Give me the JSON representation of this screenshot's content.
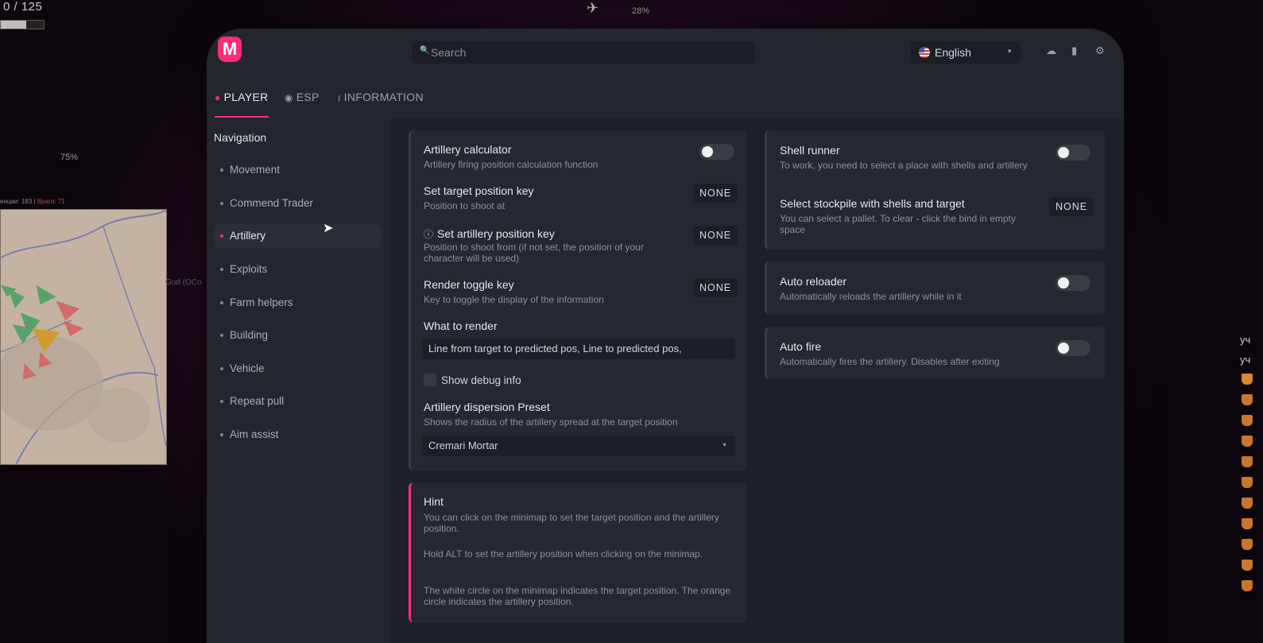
{
  "hud": {
    "counter": "0 / 125",
    "progress_fraction": 0.6,
    "top_percent": "28%",
    "side_percent": "75%",
    "stats_left": "енции: 183",
    "stats_right": "Враги: 71",
    "map_tag": "Gud (OCo",
    "right_text_1": "уч",
    "right_text_2": "уч"
  },
  "app": {
    "logo_letter": "M",
    "search": {
      "placeholder": "Search",
      "value": ""
    },
    "language": {
      "selected": "English"
    }
  },
  "tabs": [
    {
      "label": "PLAYER",
      "icon": "user-icon",
      "active": true
    },
    {
      "label": "ESP",
      "icon": "eye-icon",
      "active": false
    },
    {
      "label": "INFORMATION",
      "icon": "info-icon",
      "active": false
    }
  ],
  "nav": {
    "title": "Navigation",
    "items": [
      {
        "label": "Movement"
      },
      {
        "label": "Commend Trader"
      },
      {
        "label": "Artillery",
        "active": true
      },
      {
        "label": "Exploits"
      },
      {
        "label": "Farm helpers"
      },
      {
        "label": "Building"
      },
      {
        "label": "Vehicle"
      },
      {
        "label": "Repeat pull"
      },
      {
        "label": "Aim assist"
      }
    ]
  },
  "artillery": {
    "calculator": {
      "title": "Artillery calculator",
      "desc": "Artillery firing position calculation function",
      "enabled": false
    },
    "target_key": {
      "title": "Set target position key",
      "desc": "Position to shoot at",
      "key": "NONE"
    },
    "artillery_key": {
      "title": "Set artillery position key",
      "desc": "Position to shoot from (if not set, the position of your character will be used)",
      "key": "NONE"
    },
    "render_key": {
      "title": "Render toggle key",
      "desc": "Key to toggle the display of the information",
      "key": "NONE"
    },
    "what_to_render": {
      "title": "What to render",
      "value": "Line from target to predicted pos, Line to predicted pos,"
    },
    "debug": {
      "label": "Show debug info",
      "checked": false
    },
    "dispersion": {
      "title": "Artillery dispersion Preset",
      "desc": "Shows the radius of the artillery spread at the target position",
      "selected": "Cremari Mortar"
    }
  },
  "hint": {
    "title": "Hint",
    "p1": "You can click on the minimap to set the target position and the artillery position.",
    "p2": "Hold ALT to set the artillery position when clicking on the minimap.",
    "p3": "The white circle on the minimap indicates the target position. The orange circle indicates the artillery position."
  },
  "right": {
    "shell_runner": {
      "title": "Shell runner",
      "desc": "To work, you need to select a place with shells and artillery",
      "enabled": false
    },
    "stockpile": {
      "title": "Select stockpile with shells and target",
      "desc": "You can select a pallet. To clear - click the bind in empty space",
      "key": "NONE"
    },
    "auto_reloader": {
      "title": "Auto reloader",
      "desc": "Automatically reloads the artillery while in it",
      "enabled": false
    },
    "auto_fire": {
      "title": "Auto fire",
      "desc": "Automatically fires the artillery. Disables after exiting",
      "enabled": false
    }
  },
  "colors": {
    "accent": "#ff2d75",
    "window": "#23262d",
    "content": "#1d2026",
    "panel": "#25282f"
  }
}
